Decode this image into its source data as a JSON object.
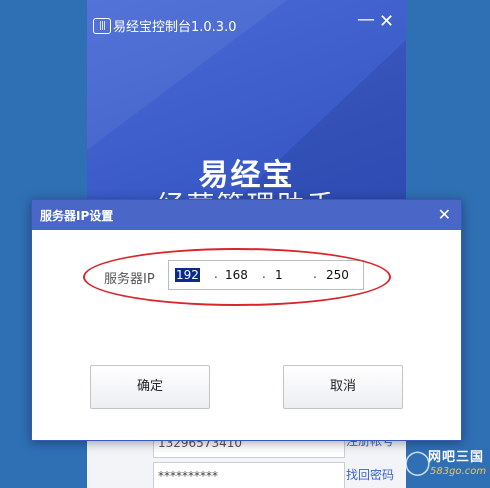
{
  "app": {
    "logo_text": "|||",
    "title": "易经宝控制台1.0.3.0",
    "minimize": "—",
    "close": "✕",
    "brand_name": "易经宝",
    "brand_subtitle": "经营管理助手"
  },
  "login": {
    "phone_value": "13296573410",
    "password_value": "**********",
    "register_link": "注册帐号",
    "recover_link": "找回密码"
  },
  "dialog": {
    "title": "服务器IP设置",
    "close": "✕",
    "ip_label": "服务器IP",
    "ip_octets": [
      "192",
      "168",
      "1",
      "250"
    ],
    "ip_separator": ".",
    "ok_label": "确定",
    "cancel_label": "取消"
  },
  "watermark": {
    "icon": "◯",
    "site": "网吧三国",
    "url": "583go.com"
  }
}
